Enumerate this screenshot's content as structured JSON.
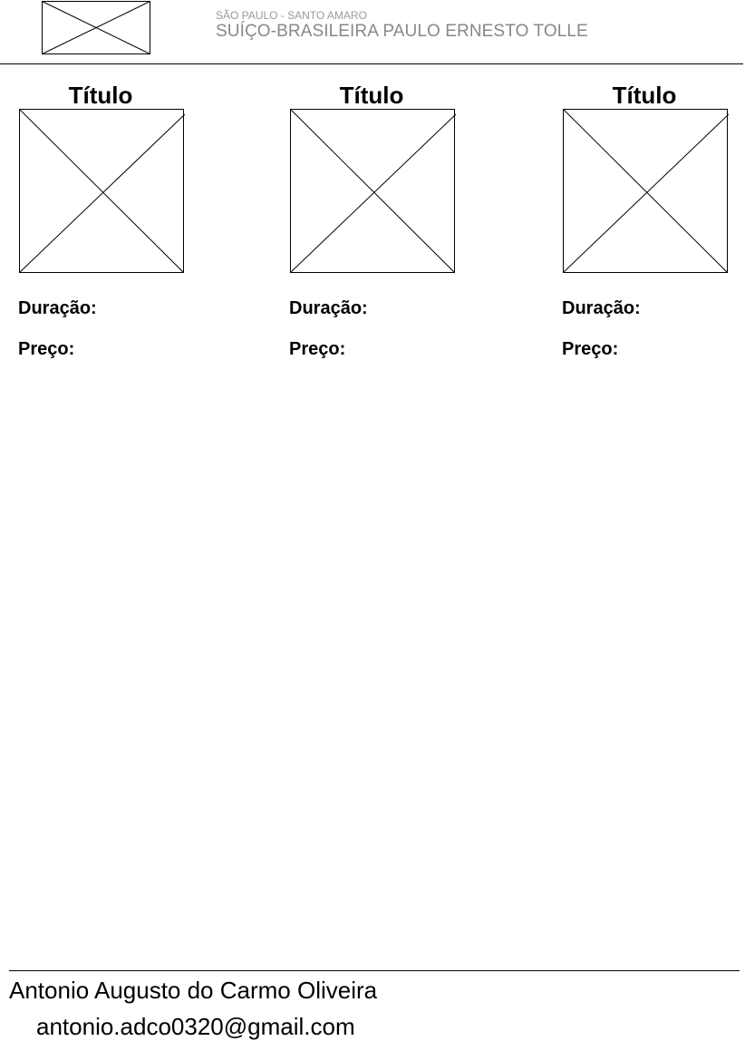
{
  "header": {
    "logo_icon": "image-placeholder-icon",
    "location": "SÃO PAULO - SANTO AMARO",
    "school_name": "SUÍÇO-BRASILEIRA PAULO ERNESTO TOLLE"
  },
  "cards": [
    {
      "title": "Título",
      "image_icon": "image-placeholder-icon",
      "duration_label": "Duração:",
      "price_label": "Preço:"
    },
    {
      "title": "Título",
      "image_icon": "image-placeholder-icon",
      "duration_label": "Duração:",
      "price_label": "Preço:"
    },
    {
      "title": "Título",
      "image_icon": "image-placeholder-icon",
      "duration_label": "Duração:",
      "price_label": "Preço:"
    }
  ],
  "footer": {
    "author": "Antonio Augusto do Carmo Oliveira",
    "email": "antonio.adco0320@gmail.com"
  }
}
